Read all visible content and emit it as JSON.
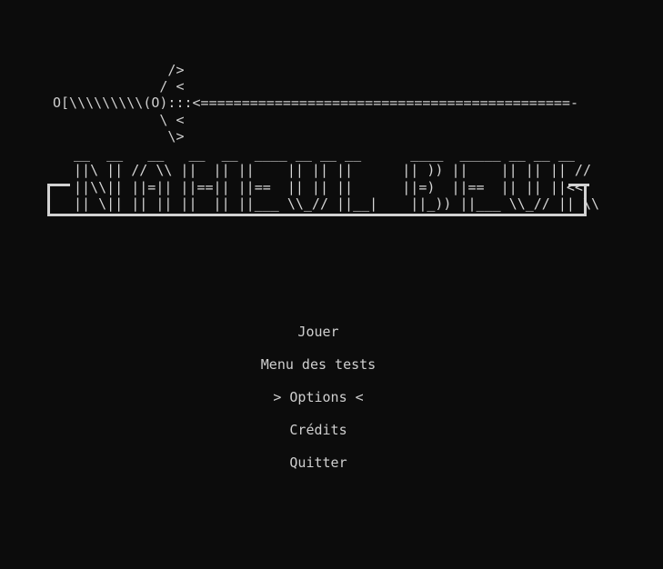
{
  "title_art": {
    "sword": "              />\n             / <\nO[\\\\\\\\\\\\\\\\\\(O):::<=============================================-\n             \\ <\n              \\>",
    "banner": " __  __   __   __  __  ____ __ __ __      ____  _____ __ __ __\n ||\\ || // \\\\ ||  || ||    || || ||      || )) ||    || || || //\n ||\\\\|| ||=|| ||==|| ||==  || || ||      ||=)  ||==  || || ||<<\n || \\|| || || ||  || ||___ \\\\_// ||__|    ||_)) ||___ \\\\_// || \\\\"
  },
  "menu": {
    "items": [
      {
        "label": "Jouer"
      },
      {
        "label": "Menu des tests"
      },
      {
        "label": "> Options <"
      },
      {
        "label": "Crédits"
      },
      {
        "label": "Quitter"
      }
    ],
    "selected_index": 2
  }
}
